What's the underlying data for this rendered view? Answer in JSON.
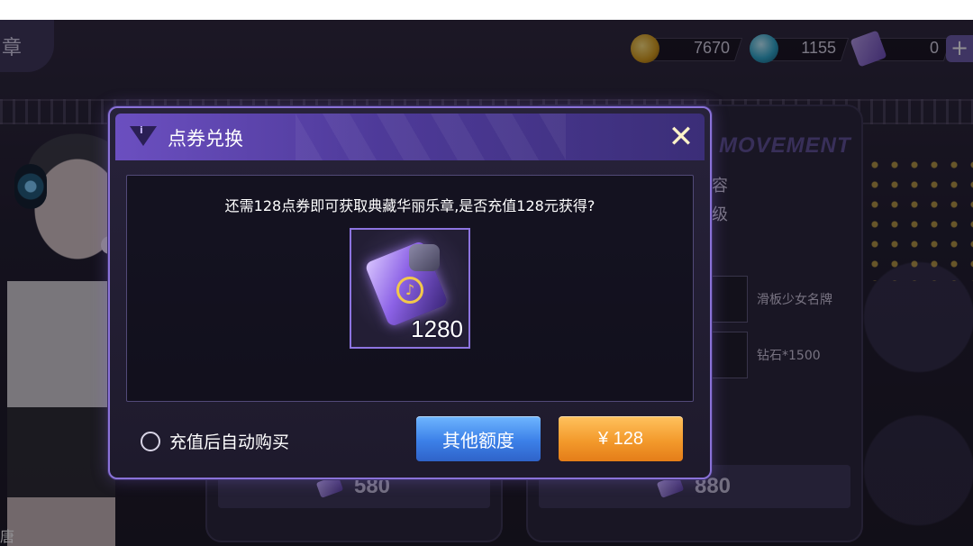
{
  "scene": {
    "title_fragment": "章",
    "side_text": "唐",
    "resources": [
      {
        "icon": "gold-coin-icon",
        "value": "7670"
      },
      {
        "icon": "diamond-icon",
        "value": "1155"
      },
      {
        "icon": "ticket-icon",
        "value": "0"
      }
    ],
    "add_label": "+",
    "background_panel": {
      "header": "MOVEMENT",
      "peek_line1": "容",
      "peek_line2": "级",
      "items": [
        {
          "label": "滑板少女名牌"
        },
        {
          "label": "钻石*1500"
        }
      ],
      "price_left": "580",
      "price_right": "880"
    }
  },
  "modal": {
    "title": "点券兑换",
    "close_symbol": "✕",
    "prompt": "还需128点券即可获取典藏华丽乐章,是否充值128元获得?",
    "item": {
      "name_icon": "music-ticket-icon",
      "count": "1280"
    },
    "auto_buy_label": "充值后自动购买",
    "other_amount_label": "其他额度",
    "pay_label": "¥ 128"
  },
  "colors": {
    "modal_border": "#8a72d8",
    "header_purple": "#6b4fc0",
    "blue_button": "#3c80e8",
    "orange_button": "#f39a2c"
  }
}
